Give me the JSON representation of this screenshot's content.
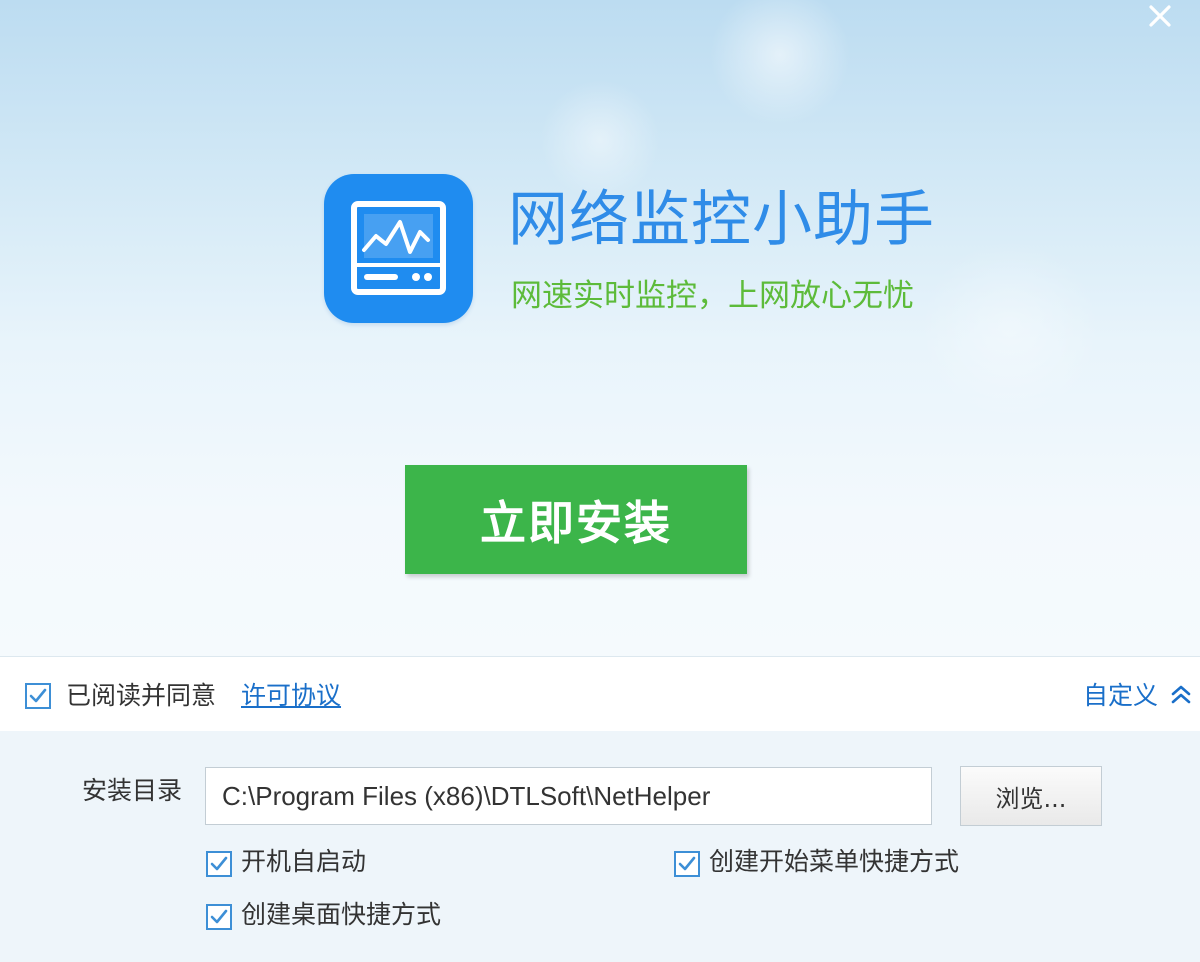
{
  "app": {
    "title": "网络监控小助手",
    "slogan": "网速实时监控，上网放心无忧",
    "icon": "monitor-icon"
  },
  "install_button": {
    "label": "立即安装"
  },
  "agreement": {
    "checked": true,
    "text": "已阅读并同意",
    "link_label": "许可协议"
  },
  "customize": {
    "label": "自定义",
    "icon": "chevron-up-icon",
    "expanded": true
  },
  "install_dir": {
    "label": "安装目录",
    "value": "C:\\Program Files (x86)\\DTLSoft\\NetHelper",
    "browse_label": "浏览..."
  },
  "options": {
    "autostart": {
      "label": "开机自启动",
      "checked": true
    },
    "start_menu_shortcut": {
      "label": "创建开始菜单快捷方式",
      "checked": true
    },
    "desktop_shortcut": {
      "label": "创建桌面快捷方式",
      "checked": true
    }
  },
  "window": {
    "close_icon": "close-icon"
  },
  "colors": {
    "title_blue": "#2f8ce8",
    "slogan_green": "#5dbb3a",
    "install_green": "#3cb54a",
    "icon_blue": "#1f8cf0",
    "link_blue": "#1a6fc9",
    "checkbox_blue": "#3d8fd6"
  }
}
